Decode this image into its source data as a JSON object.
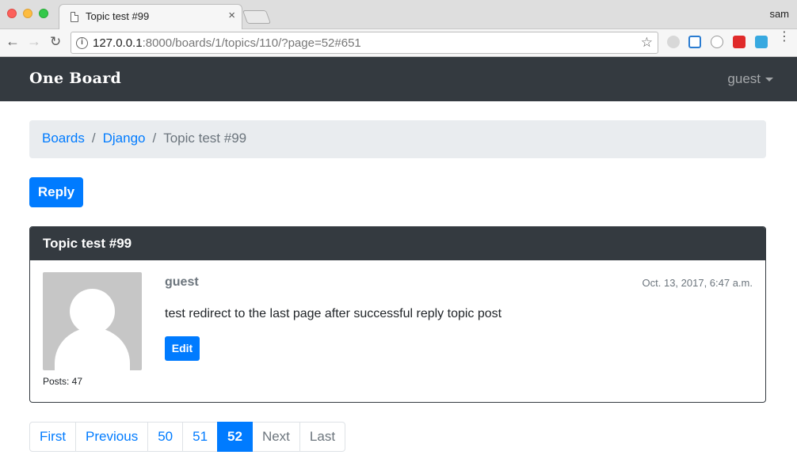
{
  "browser": {
    "tab_title": "Topic test #99",
    "tab_close": "×",
    "profile_name": "sam",
    "url_host": "127.0.0.1",
    "url_rest": ":8000/boards/1/topics/110/?page=52#651",
    "icons": {
      "back": "←",
      "forward": "→",
      "reload": "↻",
      "info": "i",
      "star": "☆",
      "menu": "⋮"
    }
  },
  "navbar": {
    "brand": "One Board",
    "user": "guest"
  },
  "breadcrumb": {
    "items": [
      "Boards",
      "Django"
    ],
    "active": "Topic test #99",
    "separator": "/"
  },
  "reply_button": "Reply",
  "post": {
    "topic_title": "Topic test #99",
    "author": "guest",
    "date": "Oct. 13, 2017, 6:47 a.m.",
    "message": "test redirect to the last page after successful reply topic post",
    "posts_count": "Posts: 47",
    "edit_label": "Edit"
  },
  "pagination": {
    "first": "First",
    "previous": "Previous",
    "pages": [
      "50",
      "51",
      "52"
    ],
    "current": "52",
    "next": "Next",
    "last": "Last"
  },
  "colors": {
    "primary": "#007bff",
    "dark": "#343a40",
    "muted": "#6c757d",
    "breadcrumb_bg": "#e9ecef"
  }
}
